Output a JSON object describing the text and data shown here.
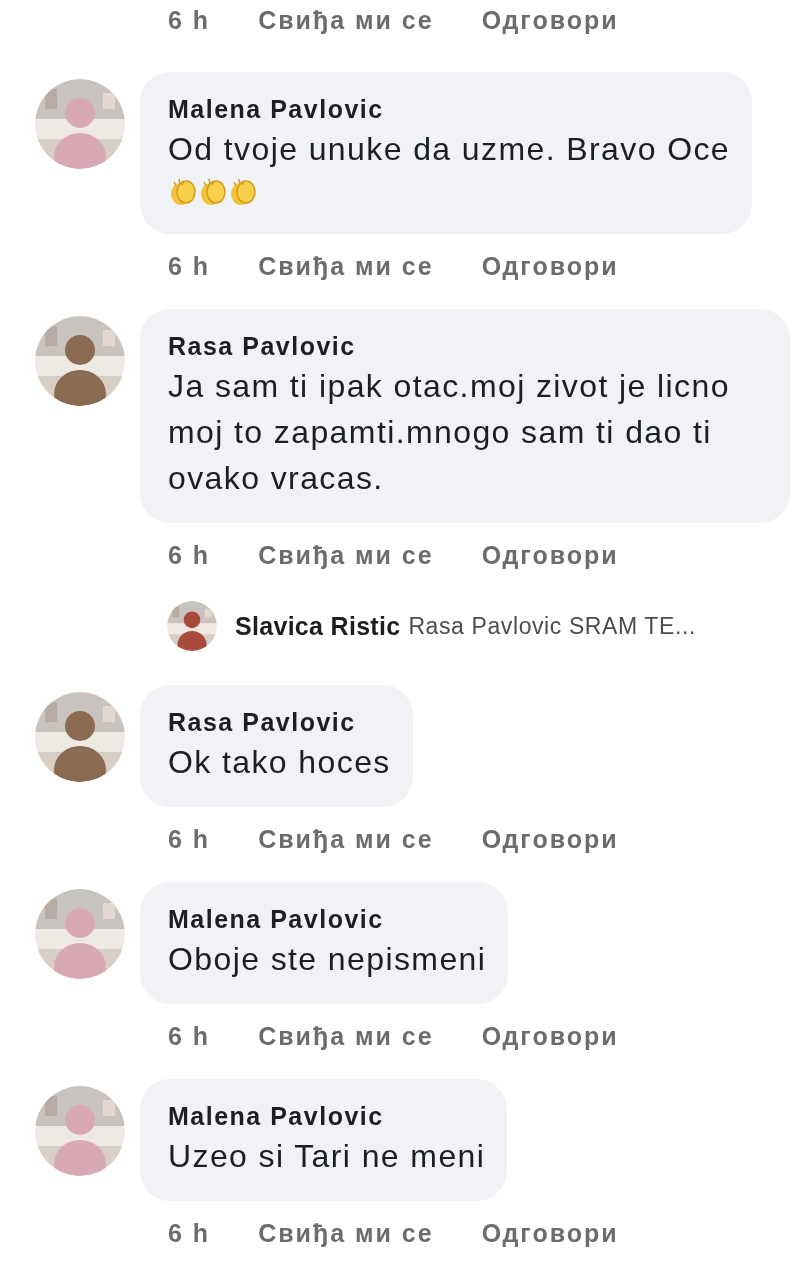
{
  "top_actions": {
    "time": "6 h",
    "like": "Свиђа ми се",
    "reply": "Одговори"
  },
  "items": [
    {
      "kind": "comment",
      "author": "Malena Pavlovic",
      "text": "Od tvoje unuke da uzme. Bravo Oce",
      "emojis": [
        {
          "kind": "clap"
        },
        {
          "kind": "clap"
        },
        {
          "kind": "clap"
        }
      ],
      "actions": {
        "time": "6 h",
        "like": "Свиђа ми се",
        "reply": "Одговори"
      }
    },
    {
      "kind": "comment",
      "author": "Rasa Pavlovic",
      "text": "Ja sam ti ipak otac.moj zivot je licno moj to zapamti.mnogo sam ti dao ti ovako vracas.",
      "actions": {
        "time": "6 h",
        "like": "Свиђа ми се",
        "reply": "Одговори"
      }
    },
    {
      "kind": "reply_preview",
      "author": "Slavica Ristic",
      "text": "Rasa Pavlovic SRAM TE..."
    },
    {
      "kind": "comment",
      "author": "Rasa Pavlovic",
      "text": "Ok tako hoces",
      "actions": {
        "time": "6 h",
        "like": "Свиђа ми се",
        "reply": "Одговори"
      }
    },
    {
      "kind": "comment",
      "author": "Malena Pavlovic",
      "text": "Oboje ste nepismeni",
      "actions": {
        "time": "6 h",
        "like": "Свиђа ми се",
        "reply": "Одговори"
      }
    },
    {
      "kind": "comment",
      "author": "Malena Pavlovic",
      "text": "Uzeo si Tari ne meni",
      "actions": {
        "time": "6 h",
        "like": "Свиђа ми се",
        "reply": "Одговори"
      }
    }
  ]
}
